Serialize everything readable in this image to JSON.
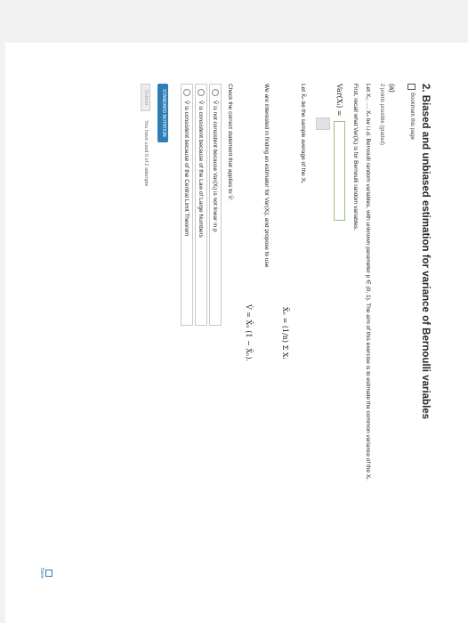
{
  "problem": {
    "title": "2. Biased and unbiased estimation for variance of Bernoulli variables",
    "bookmark_label": "Bookmark this page"
  },
  "part_a": {
    "label": "(a)",
    "points": "2 points possible (graded)",
    "intro": "Let X₁, ..., Xₙ be i.i.d. Bernoulli random variables, with unknown parameter p ∈ (0, 1). The aim of this exercise is to estimate the common variance of the Xᵢ.",
    "recall": "First, recall what Var(Xᵢ) is for Bernoulli random variables.",
    "var_label": "Var(Xᵢ) =",
    "sample_avg": "Let X̄ₙ be the sample average of the Xᵢ.",
    "sample_formula": "X̄ₙ = (1/n) Σ Xᵢ",
    "estimator_intro": "We are interested in finding an estimator for Var(Xᵢ), and propose to use",
    "estimator_formula": "V̂ = X̄ₙ (1 − X̄ₙ).",
    "question": "Check the correct statement that applies to V̂:",
    "choices": [
      "V̂ is not consistent because Var(Xᵢ) is not linear in p",
      "V̂ is consistent because of the Law of Large Numbers",
      "V̂ is consistent because of the Central Limit Theorem"
    ],
    "notation_button": "STANDARD NOTATION",
    "submit_label": "Submit",
    "attempts": "You have used 0 of 2 attempts",
    "save_label": "Save"
  }
}
